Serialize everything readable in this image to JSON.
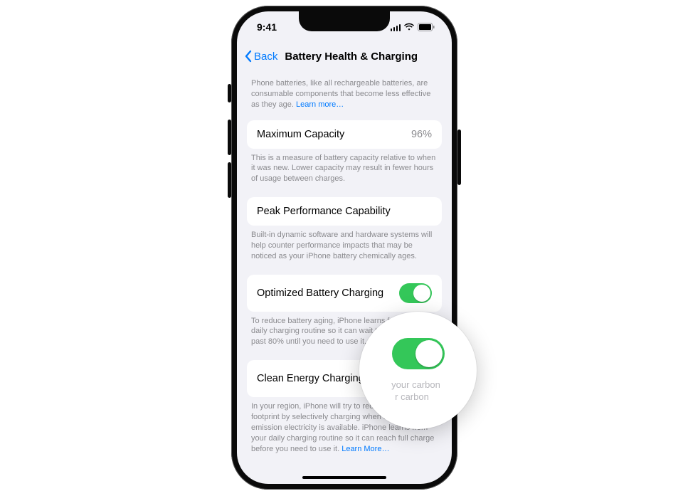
{
  "status": {
    "time": "9:41"
  },
  "nav": {
    "back": "Back",
    "title": "Battery Health & Charging"
  },
  "intro": {
    "text": "Phone batteries, like all rechargeable batteries, are consumable components that become less effective as they age. ",
    "link": "Learn more…"
  },
  "capacity": {
    "label": "Maximum Capacity",
    "value": "96%",
    "footer": "This is a measure of battery capacity relative to when it was new. Lower capacity may result in fewer hours of usage between charges."
  },
  "peak": {
    "label": "Peak Performance Capability",
    "footer": "Built-in dynamic software and hardware systems will help counter performance impacts that may be noticed as your iPhone battery chemically ages."
  },
  "optimized": {
    "label": "Optimized Battery Charging",
    "footer": "To reduce battery aging, iPhone learns from your daily charging routine so it can wait to finish charging past 80% until you need to use it."
  },
  "clean": {
    "label": "Clean Energy Charging",
    "footer": "In your region, iPhone will try to reduce your carbon footprint by selectively charging when lower carbon emission electricity is available. iPhone learns from your daily charging routine so it can reach full charge before you need to use it. ",
    "link": "Learn More…"
  },
  "magnifier": {
    "line1": "your carbon",
    "line2": "r carbon"
  }
}
